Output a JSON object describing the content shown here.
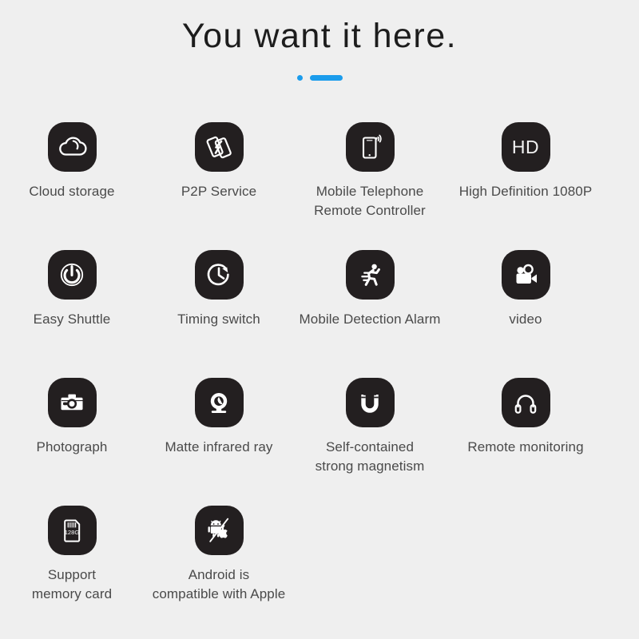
{
  "header": {
    "title": "You want it here.",
    "accent_color": "#1b9cec",
    "rule": {
      "dot": "●",
      "dash": "—"
    }
  },
  "theme": {
    "background": "#efefef",
    "icon_tile_color": "#231f20",
    "icon_glyph_color": "#ffffff",
    "label_color": "#4a4a4a",
    "title_color": "#1d1d1d"
  },
  "features": [
    [
      {
        "icon": "cloud-icon",
        "label": "Cloud storage"
      },
      {
        "icon": "p2p-phones-transfer-icon",
        "label": "P2P Service"
      },
      {
        "icon": "mobile-phone-signal-icon",
        "label": "Mobile Telephone\nRemote Controller"
      },
      {
        "icon": "hd-badge-icon",
        "icon_text": "HD",
        "label": "High Definition 1080P"
      }
    ],
    [
      {
        "icon": "power-button-icon",
        "label": "Easy Shuttle"
      },
      {
        "icon": "clock-timer-arrow-icon",
        "label": "Timing switch"
      },
      {
        "icon": "running-person-motion-icon",
        "label": "Mobile Detection Alarm"
      },
      {
        "icon": "movie-camera-icon",
        "label": "video"
      }
    ],
    [
      {
        "icon": "photo-camera-icon",
        "label": "Photograph"
      },
      {
        "icon": "webcam-icon",
        "label": "Matte infrared ray"
      },
      {
        "icon": "magnet-icon",
        "label": "Self-contained\nstrong magnetism"
      },
      {
        "icon": "headphones-icon",
        "label": "Remote monitoring"
      }
    ],
    [
      {
        "icon": "sd-memory-card-icon",
        "icon_text": "128G",
        "label": "Support\nmemory card"
      },
      {
        "icon": "android-apple-compatible-icon",
        "label": "Android is\ncompatible  with Apple"
      }
    ]
  ]
}
